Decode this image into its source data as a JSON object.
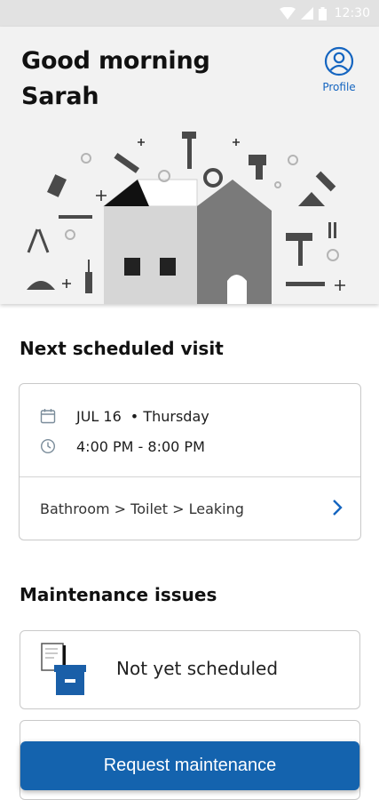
{
  "status_bar": {
    "time": "12:30"
  },
  "header": {
    "greeting_line1": "Good morning",
    "greeting_line2": "Sarah",
    "profile_label": "Profile"
  },
  "next_visit": {
    "section_title": "Next scheduled visit",
    "date": "JUL 16",
    "day": "• Thursday",
    "time_range": "4:00 PM - 8:00 PM",
    "path": "Bathroom > Toilet > Leaking"
  },
  "maintenance": {
    "section_title": "Maintenance issues",
    "issues": [
      {
        "label": "Not yet scheduled",
        "icon": "file-tray-icon"
      },
      {
        "label": "",
        "icon": "clipboard-icon"
      }
    ]
  },
  "cta": {
    "label": "Request maintenance"
  },
  "colors": {
    "accent": "#1463ae",
    "icon_blue": "#1a5fa8",
    "hero_bg": "#f2f2f2"
  }
}
